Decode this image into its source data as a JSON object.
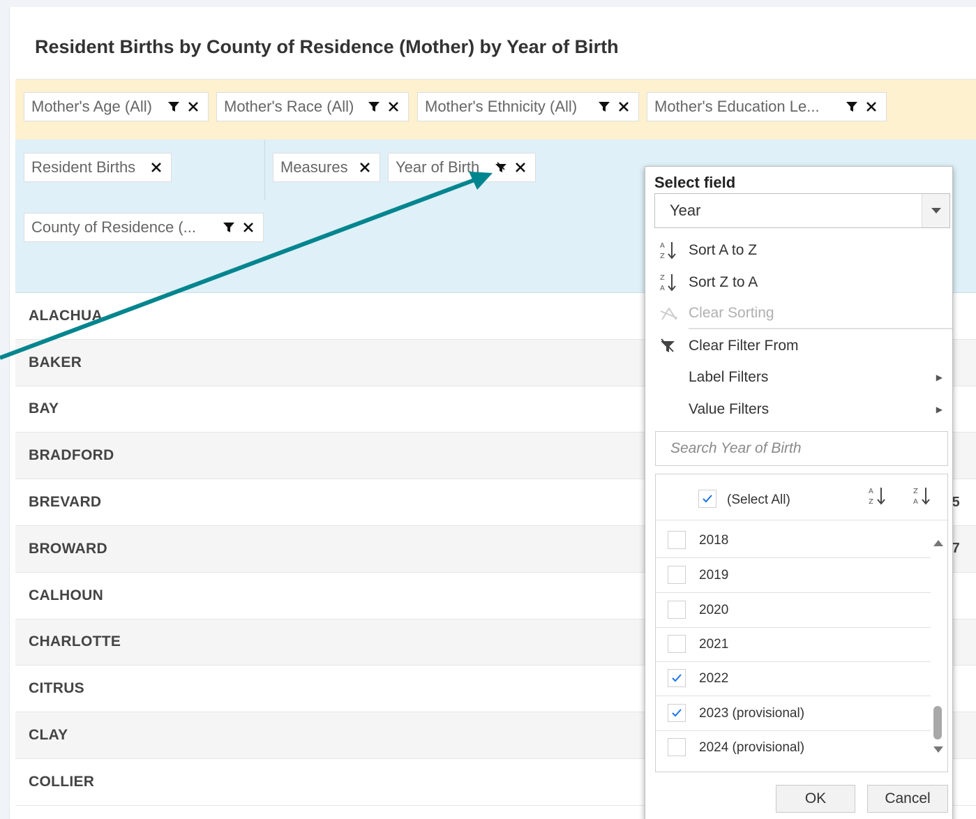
{
  "report": {
    "title": "Resident Births by County of Residence (Mother) by Year of Birth"
  },
  "filter_fields": [
    {
      "label": "Mother's Age (All)"
    },
    {
      "label": "Mother's Race (All)"
    },
    {
      "label": "Mother's Ethnicity (All)"
    },
    {
      "label": "Mother's Education Le..."
    }
  ],
  "data_fields": {
    "value": "Resident Births",
    "measures": "Measures",
    "column": "Year of Birth"
  },
  "row_field": {
    "label": "County of Residence (..."
  },
  "counties": [
    "ALACHUA",
    "BAKER",
    "BAY",
    "BRADFORD",
    "BREVARD",
    "BROWARD",
    "CALHOUN",
    "CHARLOTTE",
    "CITRUS",
    "CLAY",
    "COLLIER"
  ],
  "partial_values": {
    "brevard": "5",
    "broward": "7"
  },
  "popup": {
    "select_label": "Select field",
    "select_value": "Year",
    "sort_az": "Sort A to Z",
    "sort_za": "Sort Z to A",
    "clear_sorting": "Clear Sorting",
    "clear_filter": "Clear Filter From",
    "label_filters": "Label Filters",
    "value_filters": "Value Filters",
    "search_placeholder": "Search Year of Birth",
    "select_all": "(Select All)",
    "years": [
      {
        "label": "2018",
        "checked": false
      },
      {
        "label": "2019",
        "checked": false
      },
      {
        "label": "2020",
        "checked": false
      },
      {
        "label": "2021",
        "checked": false
      },
      {
        "label": "2022",
        "checked": true
      },
      {
        "label": "2023 (provisional)",
        "checked": true
      },
      {
        "label": "2024 (provisional)",
        "checked": false
      }
    ],
    "ok": "OK",
    "cancel": "Cancel"
  },
  "colors": {
    "filter_area": "#fdf1cf",
    "data_area": "#dff0f8",
    "arrow": "#00858f",
    "check": "#1a73e8"
  }
}
